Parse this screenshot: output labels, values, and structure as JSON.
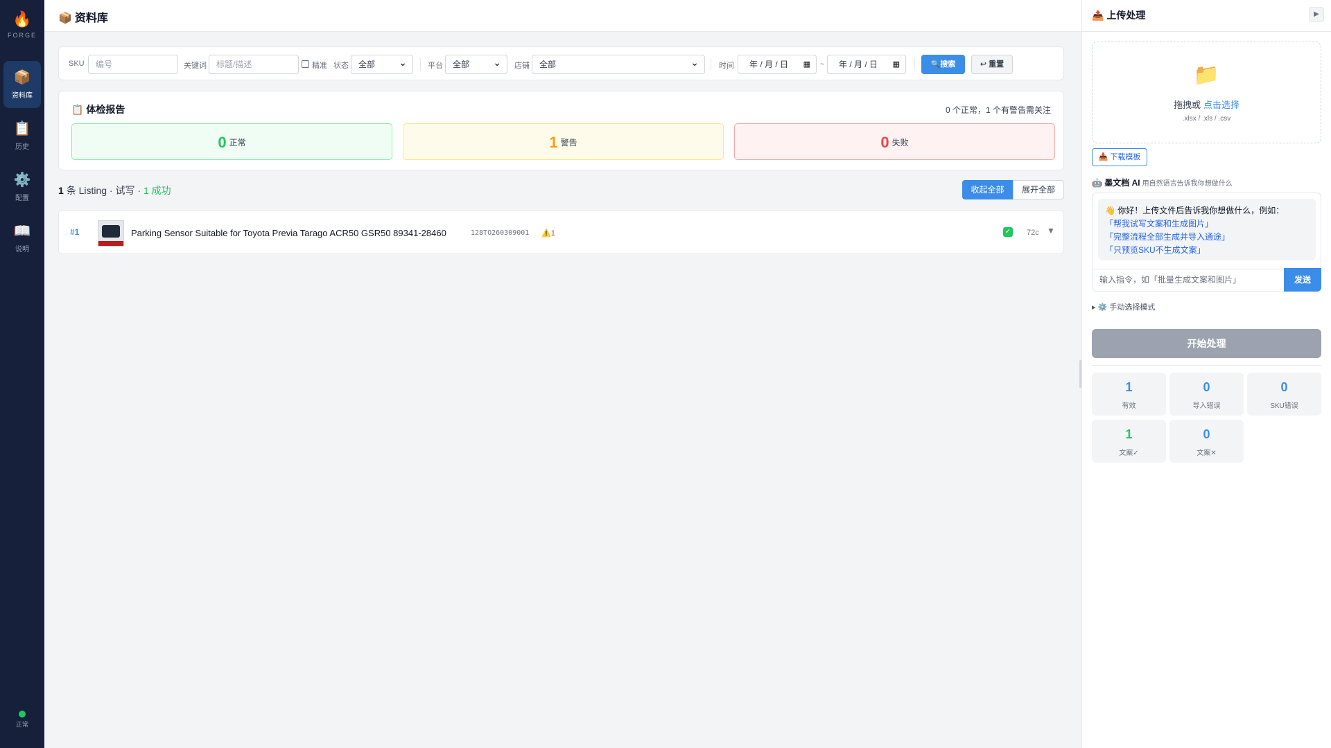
{
  "sidebar": {
    "logo": {
      "icon": "flame-icon",
      "word": "FORGE"
    },
    "items": [
      {
        "label": "资料库",
        "icon": "box-icon",
        "active": true
      },
      {
        "label": "历史",
        "icon": "clipboard-icon",
        "active": false
      },
      {
        "label": "配置",
        "icon": "gear-icon",
        "active": false
      },
      {
        "label": "说明",
        "icon": "book-icon",
        "active": false
      }
    ],
    "status_label": "正常"
  },
  "header": {
    "title": "资料库",
    "icon": "box-icon"
  },
  "filter": {
    "sku_label": "SKU",
    "sku_placeholder": "编号",
    "keyword_label": "关键词",
    "keyword_placeholder": "标题/描述",
    "exact_label": "精准",
    "status_label": "状态",
    "status_value": "全部",
    "platform_label": "平台",
    "platform_value": "全部",
    "store_label": "店铺",
    "store_value": "全部",
    "time_label": "时间",
    "date_from": "年 / 月 / 日",
    "date_to": "年 / 月 / 日",
    "date_sep": "~",
    "search_button": "搜索",
    "reset_button": "重置"
  },
  "report": {
    "title": "体检报告",
    "summary": "0 个正常，1 个有警告需关注",
    "normal": {
      "count": "0",
      "label": "正常"
    },
    "warning": {
      "count": "1",
      "label": "警告"
    },
    "failed": {
      "count": "0",
      "label": "失败"
    }
  },
  "list": {
    "count": "1",
    "head_text": "条 Listing · 试写 ·",
    "success_text": "1 成功",
    "collapse_all": "收起全部",
    "expand_all": "展开全部",
    "rows": [
      {
        "index": "#1",
        "title": "Parking Sensor Suitable for Toyota Previa Tarago ACR50 GSR50 89341-28460",
        "sku": "128TO260309001",
        "warnings": "1",
        "chars": "72c"
      }
    ]
  },
  "panel": {
    "title": "上传处理",
    "drop_text": "拖拽或",
    "drop_link": "点击选择",
    "formats": ".xlsx / .xls / .csv",
    "download_template": "下载模板",
    "ai_title": "墨文档 AI",
    "ai_subtitle": "用自然语言告诉我你想做什么",
    "greeting": "👋 你好！上传文件后告诉我你想做什么，例如：",
    "suggestions": [
      "「帮我试写文案和生成图片」",
      "「完整流程全部生成并导入通途」",
      "「只预览SKU不生成文案」"
    ],
    "input_placeholder": "输入指令，如「批量生成文案和图片」",
    "send_button": "发送",
    "manual_mode": "手动选择模式",
    "start_button": "开始处理",
    "stats": [
      {
        "value": "1",
        "label": "有效"
      },
      {
        "value": "0",
        "label": "导入错误"
      },
      {
        "value": "0",
        "label": "SKU错误"
      },
      {
        "value": "1",
        "label": "文案✓"
      },
      {
        "value": "0",
        "label": "文案✕"
      }
    ]
  },
  "colors": {
    "accent": "#3b8de8",
    "success": "#22c55e",
    "warning": "#f59e0b",
    "danger": "#ef4444",
    "sidebar": "#16203a"
  }
}
